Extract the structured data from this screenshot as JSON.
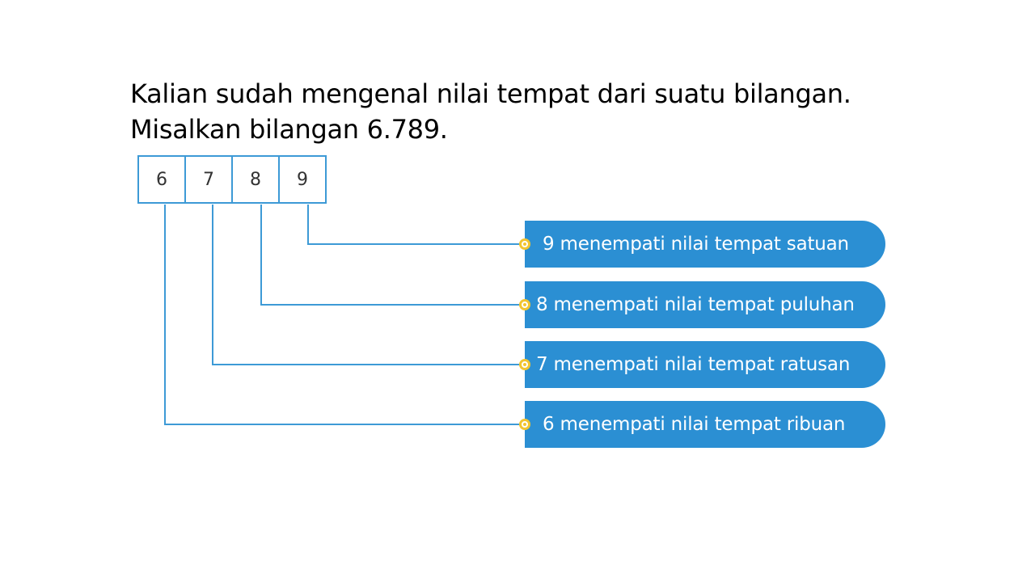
{
  "intro": {
    "line1": "Kalian sudah mengenal nilai tempat dari suatu bilangan.",
    "line2": "Misalkan bilangan 6.789."
  },
  "digits": [
    "6",
    "7",
    "8",
    "9"
  ],
  "place_labels": [
    "9 menempati nilai tempat satuan",
    "8 menempati nilai tempat puluhan",
    "7 menempati nilai tempat ratusan",
    "6 menempati nilai tempat ribuan"
  ],
  "colors": {
    "line": "#3d9ad6",
    "pill": "#2b8fd3",
    "dot": "#f2c531"
  }
}
